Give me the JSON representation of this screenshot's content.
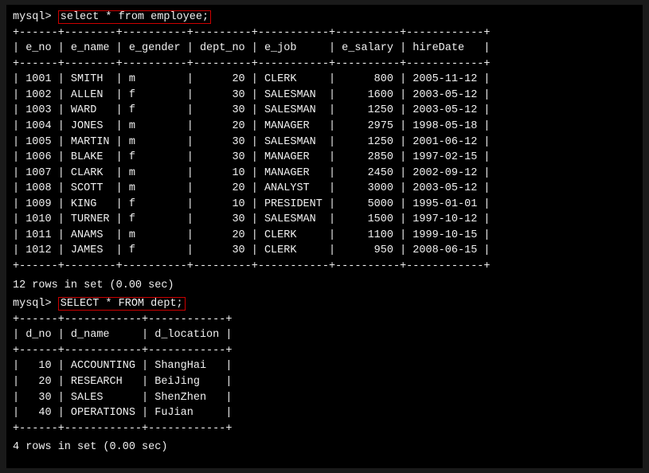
{
  "terminal": {
    "bg": "#000000",
    "fg": "#f0f0f0"
  },
  "query1": {
    "prompt": "mysql> ",
    "sql": "select * from employee;"
  },
  "table1": {
    "separator": "+------+--------+----------+---------+-----------+----------+------------+",
    "header": "| e_no | e_name | e_gender | dept_no | e_job     | e_salary | hireDate   |",
    "rows": [
      "| 1001 | SMITH  | m        |      20 | CLERK     |      800 | 2005-11-12 |",
      "| 1002 | ALLEN  | f        |      30 | SALESMAN  |     1600 | 2003-05-12 |",
      "| 1003 | WARD   | f        |      30 | SALESMAN  |     1250 | 2003-05-12 |",
      "| 1004 | JONES  | m        |      20 | MANAGER   |     2975 | 1998-05-18 |",
      "| 1005 | MARTIN | m        |      30 | SALESMAN  |     1250 | 2001-06-12 |",
      "| 1006 | BLAKE  | f        |      30 | MANAGER   |     2850 | 1997-02-15 |",
      "| 1007 | CLARK  | m        |      10 | MANAGER   |     2450 | 2002-09-12 |",
      "| 1008 | SCOTT  | m        |      20 | ANALYST   |     3000 | 2003-05-12 |",
      "| 1009 | KING   | f        |      10 | PRESIDENT |     5000 | 1995-01-01 |",
      "| 1010 | TURNER | f        |      30 | SALESMAN  |     1500 | 1997-10-12 |",
      "| 1011 | ANAMS  | m        |      20 | CLERK     |     1100 | 1999-10-15 |",
      "| 1012 | JAMES  | f        |      30 | CLERK     |      950 | 2008-06-15 |"
    ]
  },
  "result1": "12 rows in set (0.00 sec)",
  "query2": {
    "prompt": "mysql> ",
    "sql": "SELECT * FROM dept;"
  },
  "table2": {
    "separator": "+------+------------+------------+",
    "header": "| d_no | d_name     | d_location |",
    "rows": [
      "|   10 | ACCOUNTING | ShangHai   |",
      "|   20 | RESEARCH   | BeiJing    |",
      "|   30 | SALES      | ShenZhen   |",
      "|   40 | OPERATIONS | FuJian     |"
    ]
  },
  "result2": "4 rows in set (0.00 sec)"
}
